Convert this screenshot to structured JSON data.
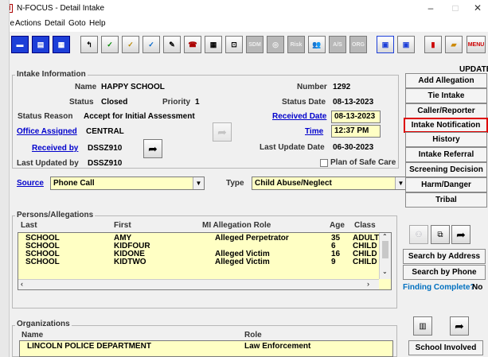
{
  "window": {
    "title": "N-FOCUS - Detail Intake",
    "minimize": "–",
    "maximize": "□",
    "close": "✕"
  },
  "menu": [
    "File",
    "Actions",
    "Detail",
    "Goto",
    "Help"
  ],
  "toolbar": {
    "icons": [
      "blue-panel-icon",
      "blue-panel-icon",
      "blue-panel-icon",
      "back-arrow-icon",
      "check-icon",
      "check-icon",
      "notepad-icon",
      "phone-icon",
      "calendar-icon",
      "car-icon",
      "sdm-icon",
      "disabled-icon",
      "risk-icon",
      "people-icon",
      "asgn-icon",
      "org-icon",
      "window-icon",
      "window-icon",
      "chart-icon",
      "folder-icon",
      "menu-icon"
    ],
    "labels": {
      "sdm": "SDM",
      "risk": "Risk",
      "asgn": "A/S",
      "org": "ORG",
      "menu": "MENU"
    }
  },
  "update_label": "UPDATE",
  "intake": {
    "section_label": "Intake Information",
    "name_label": "Name",
    "name_value": "HAPPY SCHOOL",
    "number_label": "Number",
    "number_value": "1292",
    "status_label": "Status",
    "status_value": "Closed",
    "priority_label": "Priority",
    "priority_value": "1",
    "status_date_label": "Status Date",
    "status_date_value": "08-13-2023",
    "status_reason_label": "Status Reason",
    "status_reason_value": "Accept for Initial Assessment",
    "received_date_label": "Received Date",
    "received_date_value": "08-13-2023",
    "office_label": "Office Assigned",
    "office_value": "CENTRAL",
    "time_label": "Time",
    "time_value": "12:37 PM",
    "received_by_label": "Received by",
    "received_by_value": "DSSZ910",
    "last_update_label": "Last Update Date",
    "last_update_value": "06-30-2023",
    "last_updated_by_label": "Last Updated by",
    "last_updated_by_value": "DSSZ910",
    "plan_label": "Plan of Safe Care",
    "source_label": "Source",
    "source_value": "Phone Call",
    "type_label": "Type",
    "type_value": "Child Abuse/Neglect"
  },
  "side_buttons": [
    "Add Allegation",
    "Tie Intake",
    "Caller/Reporter",
    "Intake Notification",
    "History",
    "Intake Referral",
    "Screening Decision",
    "Harm/Danger",
    "Tribal"
  ],
  "persons": {
    "section_label": "Persons/Allegations",
    "headers": {
      "last": "Last",
      "first": "First",
      "mi_role": "MI Allegation Role",
      "age": "Age",
      "class": "Class"
    },
    "rows": [
      {
        "last": "SCHOOL",
        "first": "AMY",
        "role": "Alleged Perpetrator",
        "age": "35",
        "class": "ADULT"
      },
      {
        "last": "SCHOOL",
        "first": "KIDFOUR",
        "role": "",
        "age": "6",
        "class": "CHILD"
      },
      {
        "last": "SCHOOL",
        "first": "KIDONE",
        "role": "Alleged Victim",
        "age": "16",
        "class": "CHILD"
      },
      {
        "last": "SCHOOL",
        "first": "KIDTWO",
        "role": "Alleged Victim",
        "age": "9",
        "class": "CHILD"
      }
    ]
  },
  "search_address": "Search by Address",
  "search_phone": "Search by Phone",
  "finding_label": "Finding Complete?",
  "finding_value": "No",
  "orgs": {
    "section_label": "Organizations",
    "headers": {
      "name": "Name",
      "role": "Role"
    },
    "rows": [
      {
        "name": "LINCOLN POLICE DEPARTMENT",
        "role": "Law Enforcement"
      }
    ]
  },
  "school_involved": "School Involved",
  "colors": {
    "accent_blue": "#1d3fd8",
    "input_yellow": "#ffffc4",
    "selected_border": "#dd0000",
    "link": "#0000cc"
  }
}
